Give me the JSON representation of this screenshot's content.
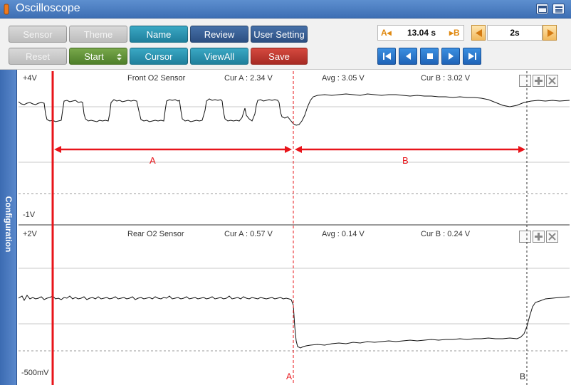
{
  "window": {
    "title": "Oscilloscope"
  },
  "toolbar": {
    "row1": [
      {
        "label": "Sensor",
        "style": "gray"
      },
      {
        "label": "Theme",
        "style": "gray"
      },
      {
        "label": "Name",
        "style": "teal"
      },
      {
        "label": "Review",
        "style": "navy"
      },
      {
        "label": "User Setting",
        "style": "navy"
      }
    ],
    "row2": [
      {
        "label": "Reset",
        "style": "gray"
      },
      {
        "label": "Start",
        "style": "green"
      },
      {
        "label": "Cursor",
        "style": "teal"
      },
      {
        "label": "ViewAll",
        "style": "teal"
      },
      {
        "label": "Save",
        "style": "red"
      }
    ],
    "cursor_left_label": "A◂",
    "cursor_delta": "13.04 s",
    "cursor_right_label": "▸B",
    "timebase": "2s"
  },
  "sidetab": {
    "label": "Configuration"
  },
  "panels": [
    {
      "top_range": "+4V",
      "bottom_range": "-1V",
      "name": "Front O2 Sensor",
      "cur_a": "Cur A : 2.34 V",
      "avg": "Avg : 3.05 V",
      "cur_b": "Cur B : 3.02 V"
    },
    {
      "top_range": "+2V",
      "bottom_range": "-500mV",
      "name": "Rear O2 Sensor",
      "cur_a": "Cur A : 0.57 V",
      "avg": "Avg : 0.14 V",
      "cur_b": "Cur B : 0.24 V"
    }
  ],
  "annotations": {
    "segment_a": "A",
    "segment_b": "B"
  },
  "cursors": {
    "a_label": "A",
    "b_label": "B"
  },
  "colors": {
    "trace": "#111111",
    "annotation": "#e8141a",
    "accent": "#3e6fb4"
  }
}
